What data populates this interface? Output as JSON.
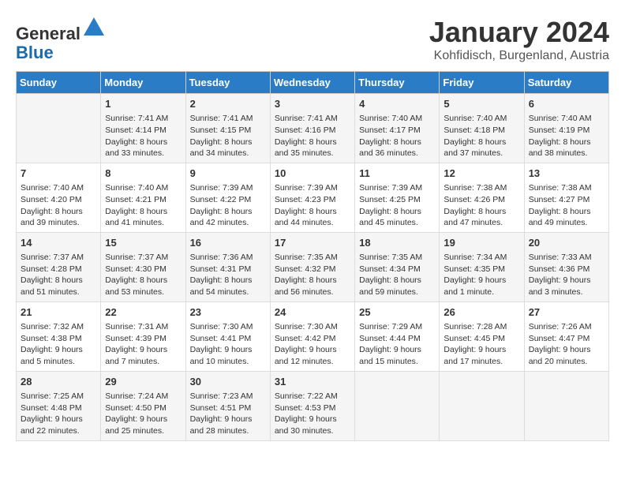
{
  "header": {
    "logo_general": "General",
    "logo_blue": "Blue",
    "month": "January 2024",
    "location": "Kohfidisch, Burgenland, Austria"
  },
  "days_of_week": [
    "Sunday",
    "Monday",
    "Tuesday",
    "Wednesday",
    "Thursday",
    "Friday",
    "Saturday"
  ],
  "weeks": [
    [
      {
        "day": "",
        "info": ""
      },
      {
        "day": "1",
        "info": "Sunrise: 7:41 AM\nSunset: 4:14 PM\nDaylight: 8 hours\nand 33 minutes."
      },
      {
        "day": "2",
        "info": "Sunrise: 7:41 AM\nSunset: 4:15 PM\nDaylight: 8 hours\nand 34 minutes."
      },
      {
        "day": "3",
        "info": "Sunrise: 7:41 AM\nSunset: 4:16 PM\nDaylight: 8 hours\nand 35 minutes."
      },
      {
        "day": "4",
        "info": "Sunrise: 7:40 AM\nSunset: 4:17 PM\nDaylight: 8 hours\nand 36 minutes."
      },
      {
        "day": "5",
        "info": "Sunrise: 7:40 AM\nSunset: 4:18 PM\nDaylight: 8 hours\nand 37 minutes."
      },
      {
        "day": "6",
        "info": "Sunrise: 7:40 AM\nSunset: 4:19 PM\nDaylight: 8 hours\nand 38 minutes."
      }
    ],
    [
      {
        "day": "7",
        "info": "Sunrise: 7:40 AM\nSunset: 4:20 PM\nDaylight: 8 hours\nand 39 minutes."
      },
      {
        "day": "8",
        "info": "Sunrise: 7:40 AM\nSunset: 4:21 PM\nDaylight: 8 hours\nand 41 minutes."
      },
      {
        "day": "9",
        "info": "Sunrise: 7:39 AM\nSunset: 4:22 PM\nDaylight: 8 hours\nand 42 minutes."
      },
      {
        "day": "10",
        "info": "Sunrise: 7:39 AM\nSunset: 4:23 PM\nDaylight: 8 hours\nand 44 minutes."
      },
      {
        "day": "11",
        "info": "Sunrise: 7:39 AM\nSunset: 4:25 PM\nDaylight: 8 hours\nand 45 minutes."
      },
      {
        "day": "12",
        "info": "Sunrise: 7:38 AM\nSunset: 4:26 PM\nDaylight: 8 hours\nand 47 minutes."
      },
      {
        "day": "13",
        "info": "Sunrise: 7:38 AM\nSunset: 4:27 PM\nDaylight: 8 hours\nand 49 minutes."
      }
    ],
    [
      {
        "day": "14",
        "info": "Sunrise: 7:37 AM\nSunset: 4:28 PM\nDaylight: 8 hours\nand 51 minutes."
      },
      {
        "day": "15",
        "info": "Sunrise: 7:37 AM\nSunset: 4:30 PM\nDaylight: 8 hours\nand 53 minutes."
      },
      {
        "day": "16",
        "info": "Sunrise: 7:36 AM\nSunset: 4:31 PM\nDaylight: 8 hours\nand 54 minutes."
      },
      {
        "day": "17",
        "info": "Sunrise: 7:35 AM\nSunset: 4:32 PM\nDaylight: 8 hours\nand 56 minutes."
      },
      {
        "day": "18",
        "info": "Sunrise: 7:35 AM\nSunset: 4:34 PM\nDaylight: 8 hours\nand 59 minutes."
      },
      {
        "day": "19",
        "info": "Sunrise: 7:34 AM\nSunset: 4:35 PM\nDaylight: 9 hours\nand 1 minute."
      },
      {
        "day": "20",
        "info": "Sunrise: 7:33 AM\nSunset: 4:36 PM\nDaylight: 9 hours\nand 3 minutes."
      }
    ],
    [
      {
        "day": "21",
        "info": "Sunrise: 7:32 AM\nSunset: 4:38 PM\nDaylight: 9 hours\nand 5 minutes."
      },
      {
        "day": "22",
        "info": "Sunrise: 7:31 AM\nSunset: 4:39 PM\nDaylight: 9 hours\nand 7 minutes."
      },
      {
        "day": "23",
        "info": "Sunrise: 7:30 AM\nSunset: 4:41 PM\nDaylight: 9 hours\nand 10 minutes."
      },
      {
        "day": "24",
        "info": "Sunrise: 7:30 AM\nSunset: 4:42 PM\nDaylight: 9 hours\nand 12 minutes."
      },
      {
        "day": "25",
        "info": "Sunrise: 7:29 AM\nSunset: 4:44 PM\nDaylight: 9 hours\nand 15 minutes."
      },
      {
        "day": "26",
        "info": "Sunrise: 7:28 AM\nSunset: 4:45 PM\nDaylight: 9 hours\nand 17 minutes."
      },
      {
        "day": "27",
        "info": "Sunrise: 7:26 AM\nSunset: 4:47 PM\nDaylight: 9 hours\nand 20 minutes."
      }
    ],
    [
      {
        "day": "28",
        "info": "Sunrise: 7:25 AM\nSunset: 4:48 PM\nDaylight: 9 hours\nand 22 minutes."
      },
      {
        "day": "29",
        "info": "Sunrise: 7:24 AM\nSunset: 4:50 PM\nDaylight: 9 hours\nand 25 minutes."
      },
      {
        "day": "30",
        "info": "Sunrise: 7:23 AM\nSunset: 4:51 PM\nDaylight: 9 hours\nand 28 minutes."
      },
      {
        "day": "31",
        "info": "Sunrise: 7:22 AM\nSunset: 4:53 PM\nDaylight: 9 hours\nand 30 minutes."
      },
      {
        "day": "",
        "info": ""
      },
      {
        "day": "",
        "info": ""
      },
      {
        "day": "",
        "info": ""
      }
    ]
  ]
}
